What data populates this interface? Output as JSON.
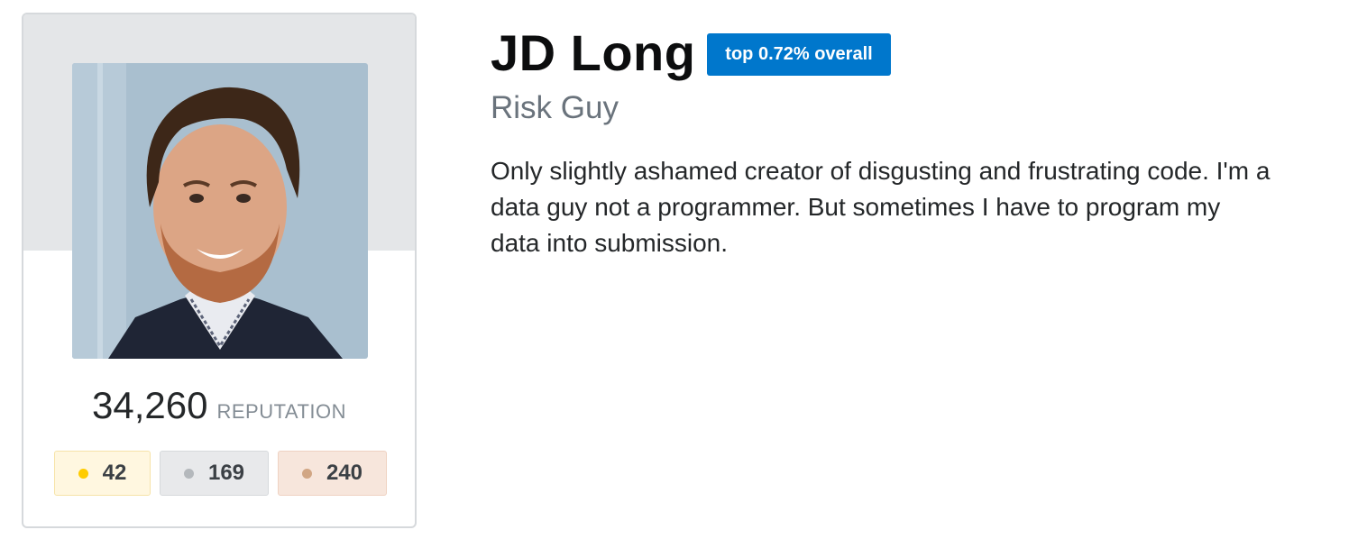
{
  "profile": {
    "name": "JD Long",
    "rank_badge": "top 0.72% overall",
    "title": "Risk Guy",
    "bio": "Only slightly ashamed creator of disgusting and frustrating code. I'm a\ndata guy not a programmer. But sometimes I have to program my\ndata into submission.",
    "avatar": "profile-photo"
  },
  "stats": {
    "reputation": "34,260",
    "reputation_label": "REPUTATION"
  },
  "badges": {
    "gold": "42",
    "silver": "169",
    "bronze": "240"
  },
  "colors": {
    "accent": "#0077cc",
    "gold": "#ffcc01",
    "silver": "#b4b8bc",
    "bronze": "#d1a684"
  }
}
